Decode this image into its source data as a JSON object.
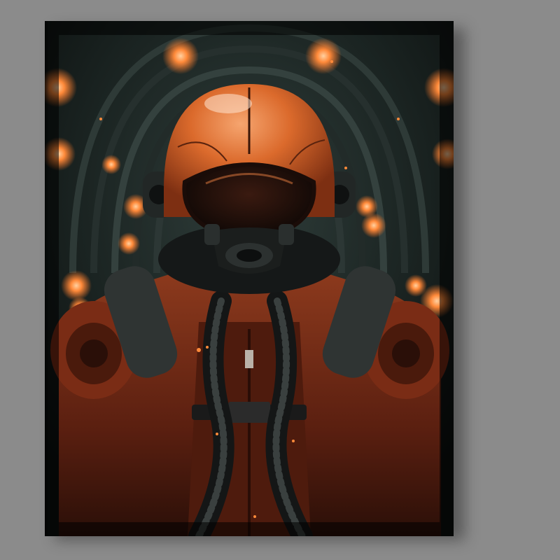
{
  "artwork": {
    "subject": "astronaut-in-orange-helmet",
    "colors": {
      "background": "#8b8b8b",
      "tunnel": "#1f2a28",
      "accent": "#e0682a",
      "suit": "#6a2a1a",
      "helmet": "#d2662f"
    }
  }
}
